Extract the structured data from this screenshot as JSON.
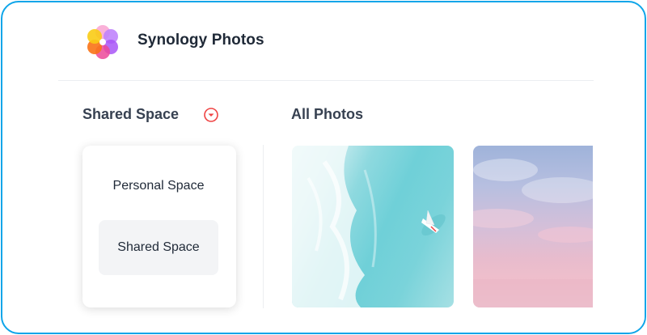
{
  "app": {
    "title": "Synology Photos",
    "logo_icon": "synology-photos-flower-icon"
  },
  "space_selector": {
    "current": "Shared Space",
    "dropdown_icon": "chevron-down-circle-icon",
    "accent_color": "#ef4444",
    "options": [
      {
        "label": "Personal Space",
        "selected": false
      },
      {
        "label": "Shared Space",
        "selected": true
      }
    ]
  },
  "photos": {
    "title": "All Photos",
    "items": [
      {
        "subject": "aerial-ocean-boat"
      },
      {
        "subject": "pink-sunset-clouds"
      }
    ]
  },
  "colors": {
    "frame_border": "#0ea5e9",
    "text_primary": "#1f2937",
    "selected_bg": "#f3f4f6"
  }
}
